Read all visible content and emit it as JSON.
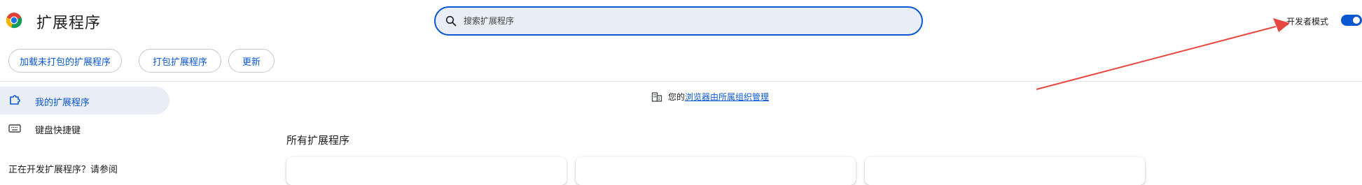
{
  "header": {
    "title": "扩展程序",
    "search_placeholder": "搜索扩展程序",
    "dev_mode_label": "开发者模式",
    "dev_mode_enabled": true
  },
  "actions": {
    "load_unpacked": "加载未打包的扩展程序",
    "pack": "打包扩展程序",
    "update": "更新"
  },
  "sidebar": {
    "items": [
      {
        "label": "我的扩展程序",
        "icon": "extension-icon",
        "active": true
      },
      {
        "label": "键盘快捷键",
        "icon": "keyboard-icon",
        "active": false
      }
    ],
    "more_text": "正在开发扩展程序？请参阅"
  },
  "main": {
    "managed_prefix": "您的",
    "managed_link": "浏览器由所属组织管理",
    "section_title": "所有扩展程序"
  },
  "colors": {
    "accent": "#0b57d0",
    "annotation_arrow": "#e8473f"
  }
}
